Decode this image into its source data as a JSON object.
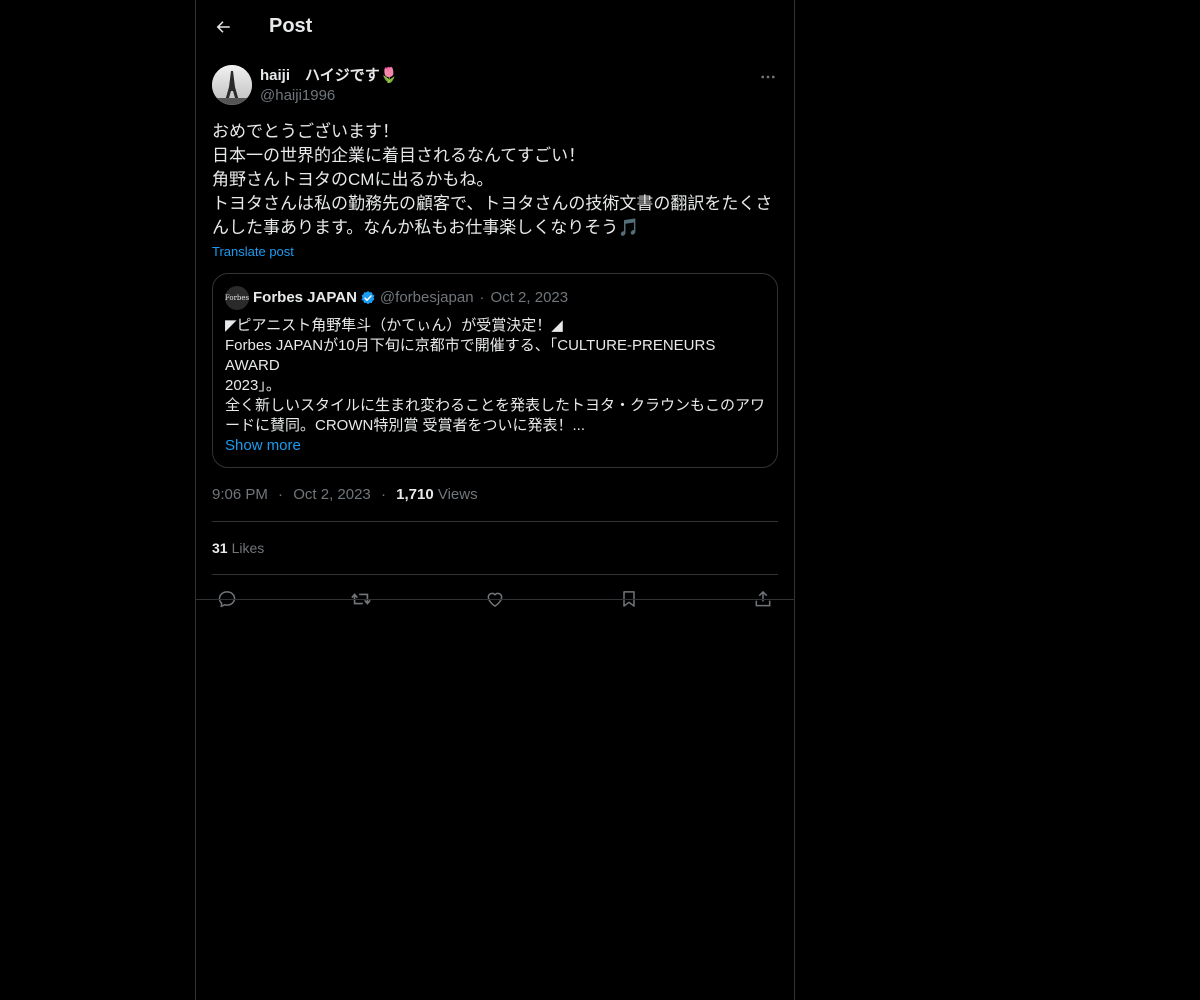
{
  "header": {
    "title": "Post"
  },
  "post": {
    "author_name": "haiji　ハイジです🌷",
    "author_handle": "@haiji1996",
    "text_lines": [
      "おめでとうございます！",
      "日本一の世界的企業に着目されるなんてすごい！",
      "角野さんトヨタのCMに出るかもね。",
      "トヨタさんは私の勤務先の顧客で、トヨタさんの技術文書の翻訳をたくさ",
      "んした事あります。なんか私もお仕事楽しくなりそう🎵"
    ],
    "translate_label": "Translate post",
    "time": "9:06 PM",
    "date": "Oct 2, 2023",
    "views_count": "1,710",
    "views_label": "Views",
    "likes_count": "31",
    "likes_label": "Likes"
  },
  "quote": {
    "avatar_text": "Forbes",
    "name": "Forbes JAPAN",
    "handle": "@forbesjapan",
    "date": "Oct 2, 2023",
    "text_lines": [
      "◤ピアニスト角野隼斗（かてぃん）が受賞決定！◢",
      "Forbes JAPANが10月下旬に京都市で開催する、「CULTURE-PRENEURS AWARD",
      "2023」。",
      "全く新しいスタイルに生まれ変わることを発表したトヨタ・クラウンもこのアワ",
      "ードに賛同。CROWN特別賞 受賞者をついに発表！..."
    ],
    "show_more_label": "Show more"
  },
  "icons": {
    "back": "back-arrow-icon",
    "more": "more-dots-icon",
    "verified": "verified-badge-icon",
    "reply": "reply-icon",
    "retweet": "retweet-icon",
    "like": "heart-icon",
    "bookmark": "bookmark-icon",
    "share": "share-icon"
  },
  "colors": {
    "background": "#000000",
    "text": "#e7e9ea",
    "muted": "#71767b",
    "accent": "#1d9bf0",
    "border": "#2f3336"
  }
}
